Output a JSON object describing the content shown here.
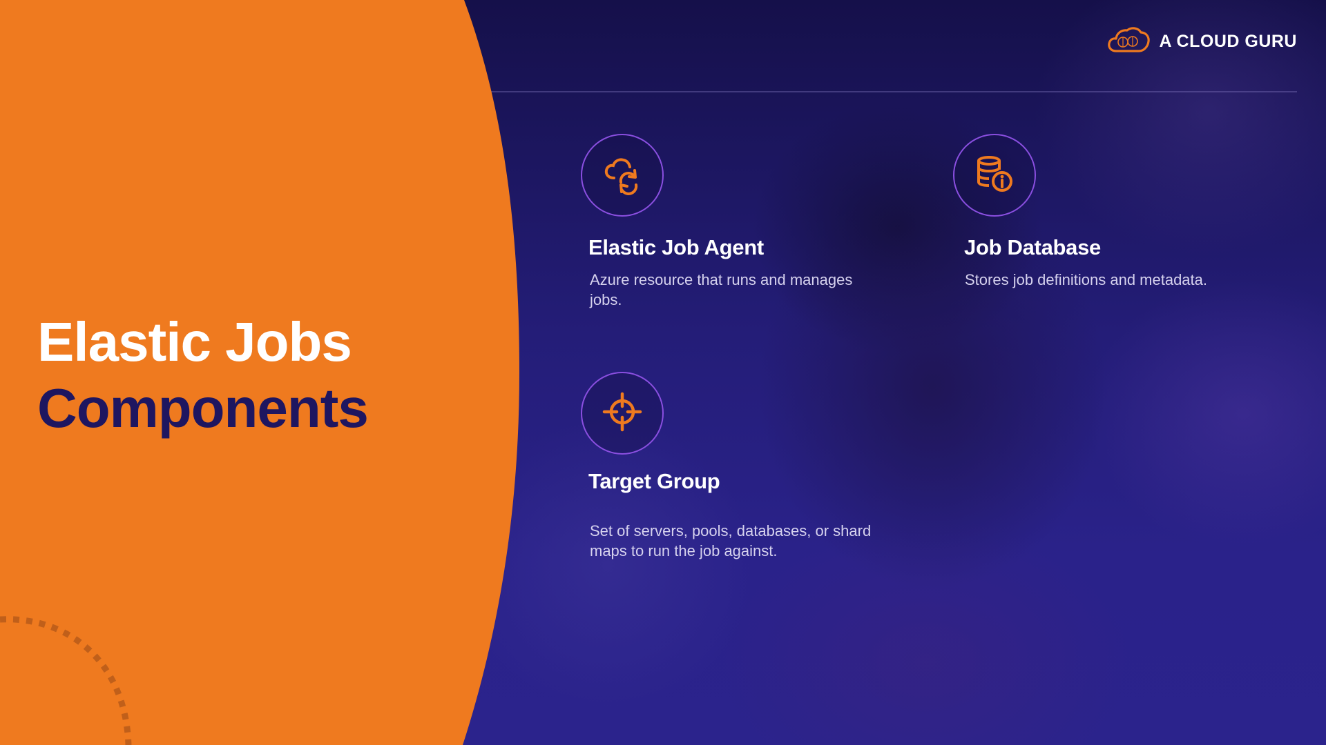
{
  "slide": {
    "title_line1": "Elastic Jobs",
    "title_line2": "Components"
  },
  "brand": {
    "name": "A CLOUD GURU",
    "icon": "cloud-logo-icon"
  },
  "components": [
    {
      "title": "Elastic Job Agent",
      "description": "Azure resource that runs and manages jobs.",
      "icon": "cloud-sync-icon"
    },
    {
      "title": "Job Database",
      "description": "Stores job definitions and metadata.",
      "icon": "database-info-icon"
    },
    {
      "title": "Target Group",
      "description": "Set of servers, pools, databases, or shard maps to run the job against.",
      "icon": "crosshair-icon"
    }
  ],
  "colors": {
    "accent_orange": "#ef7a1f",
    "title_dark": "#1e1660",
    "icon_ring": "#8a4fe0",
    "background": "#241d78"
  }
}
